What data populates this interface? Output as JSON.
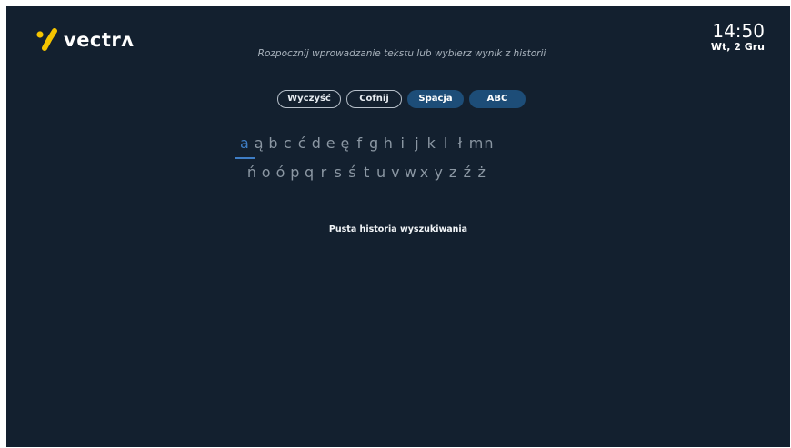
{
  "brand": {
    "name": "vectrʌ",
    "logo_icon": "vectra-logo-icon",
    "accent_color": "#f5c400"
  },
  "clock": {
    "time": "14:50",
    "date": "Wt, 2 Gru"
  },
  "search": {
    "placeholder": "Rozpocznij wprowadzanie tekstu lub wybierz wynik z historii",
    "value": ""
  },
  "controls": {
    "clear_label": "Wyczyść",
    "undo_label": "Cofnij",
    "space_label": "Spacja",
    "abc_label": "ABC"
  },
  "keyboard": {
    "selected_key": "a",
    "row1": [
      "a",
      "ą",
      "b",
      "c",
      "ć",
      "d",
      "e",
      "ę",
      "f",
      "g",
      "h",
      "i",
      "j",
      "k",
      "l",
      "ł",
      "m",
      "n"
    ],
    "row2": [
      "ń",
      "o",
      "ó",
      "p",
      "q",
      "r",
      "s",
      "ś",
      "t",
      "u",
      "v",
      "w",
      "x",
      "y",
      "z",
      "ź",
      "ż"
    ]
  },
  "history": {
    "empty_message": "Pusta historia wyszukiwania"
  },
  "colors": {
    "background": "#13202f",
    "button_fill": "#1d4d78",
    "active_key": "#3e7dc5",
    "inactive_key": "#8b97a3"
  }
}
